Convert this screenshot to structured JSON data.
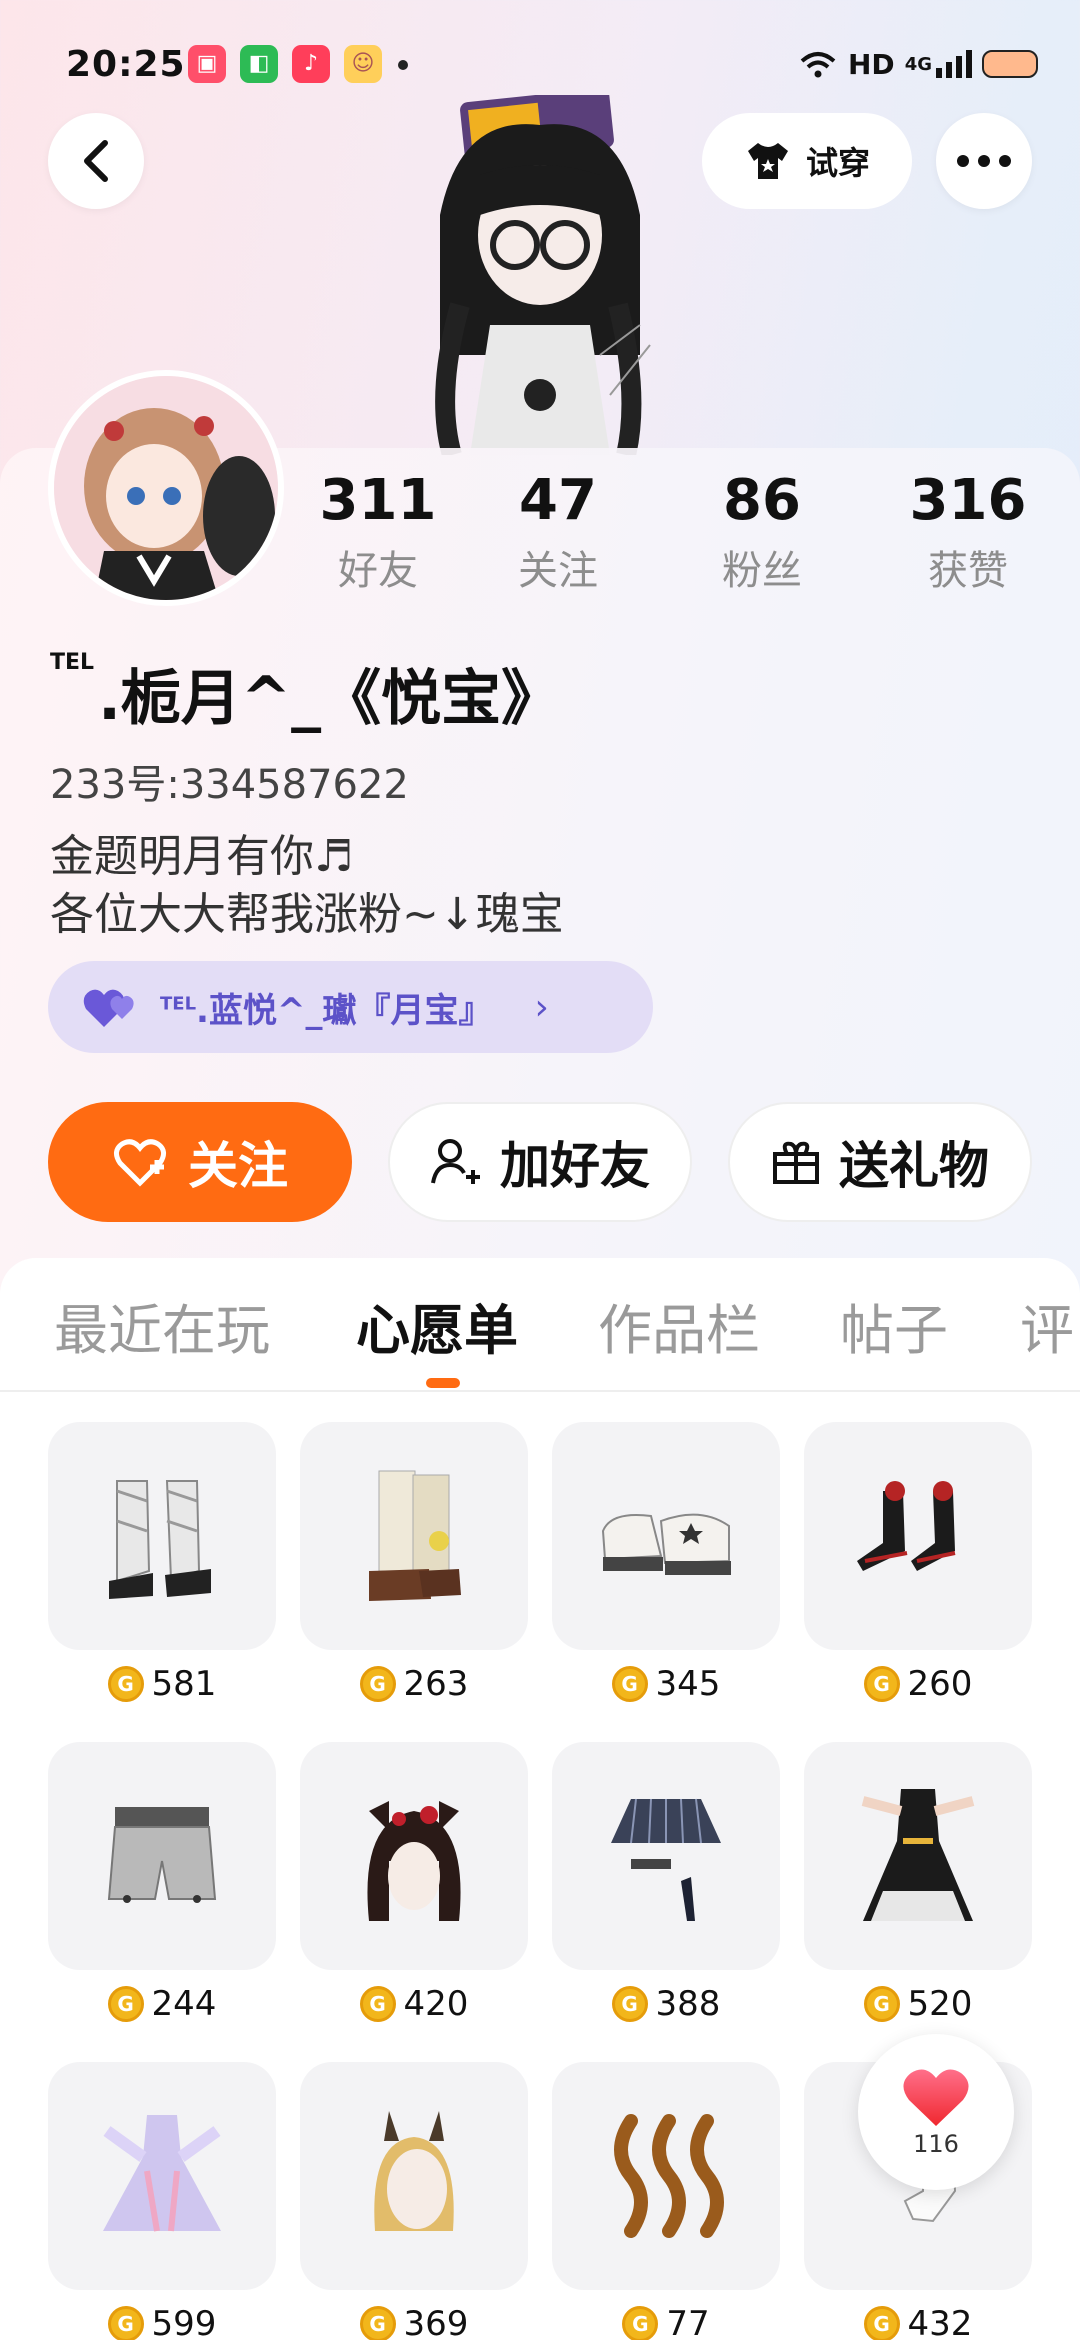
{
  "status_bar": {
    "time": "20:25",
    "network_label": "HD",
    "cell_label": "4G"
  },
  "header": {
    "try_on_label": "试穿"
  },
  "profile": {
    "stats": [
      {
        "value": "311",
        "label": "好友"
      },
      {
        "value": "47",
        "label": "关注"
      },
      {
        "value": "86",
        "label": "粉丝"
      },
      {
        "value": "316",
        "label": "获赞"
      }
    ],
    "nickname_prefix": "TEL",
    "nickname": ".栀月^_《悦宝》",
    "id_line": "233号:334587622",
    "bio_lines": [
      "金题明月有你♬",
      "各位大大帮我涨粉~↓瑰宝"
    ],
    "partner": {
      "prefix": "TEL",
      "name": ".蓝悦^_瓛『月宝』"
    }
  },
  "actions": {
    "follow": "关注",
    "add_friend": "加好友",
    "send_gift": "送礼物"
  },
  "tabs": [
    "最近在玩",
    "心愿单",
    "作品栏",
    "帖子",
    "评"
  ],
  "active_tab": 1,
  "wishlist": [
    {
      "price": "581",
      "icon": "white-bow-boots"
    },
    {
      "price": "263",
      "icon": "cream-leg-warmer-boots"
    },
    {
      "price": "345",
      "icon": "white-platform-sneakers"
    },
    {
      "price": "260",
      "icon": "black-red-heels"
    },
    {
      "price": "244",
      "icon": "grey-shorts"
    },
    {
      "price": "420",
      "icon": "black-hair-red-bow"
    },
    {
      "price": "388",
      "icon": "plaid-skirt"
    },
    {
      "price": "520",
      "icon": "black-gold-dress"
    },
    {
      "price": "599",
      "icon": "lavender-gown"
    },
    {
      "price": "369",
      "icon": "blonde-bunny-hair"
    },
    {
      "price": "77",
      "icon": "brown-wavy-accessory"
    },
    {
      "price": "432",
      "icon": "lace-glove"
    }
  ],
  "like_count": "116",
  "colors": {
    "accent": "#ff6b12",
    "partner": "#5c52c8",
    "coin": "#f2b61b"
  }
}
